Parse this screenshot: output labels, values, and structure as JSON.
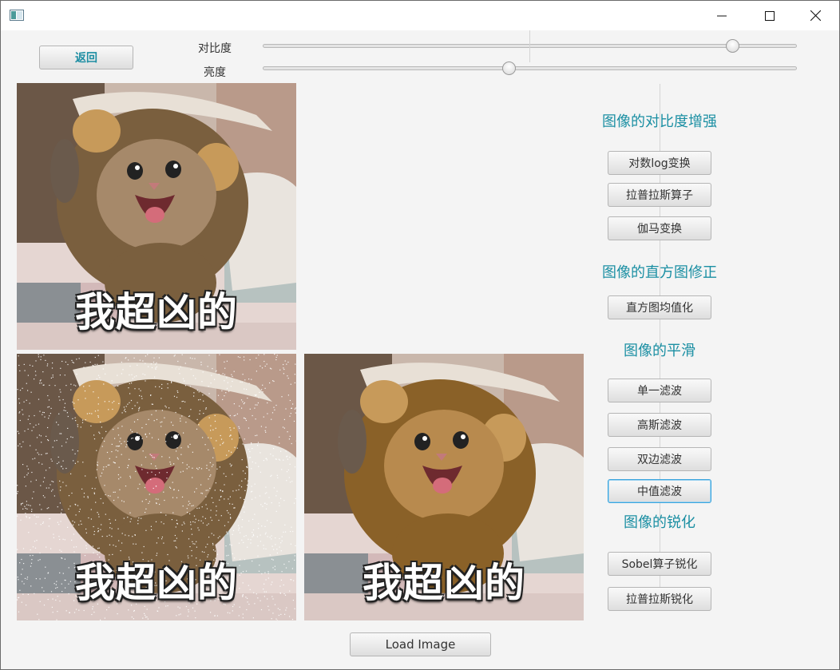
{
  "titlebar": {
    "icons": [
      "app-icon",
      "minimize-icon",
      "maximize-icon",
      "close-icon"
    ]
  },
  "toolbar": {
    "back_label": "返回"
  },
  "sliders": {
    "contrast": {
      "label": "对比度",
      "fraction": 0.89
    },
    "brightness": {
      "label": "亮度",
      "fraction": 0.46
    }
  },
  "images": {
    "original": {
      "caption": "我超凶的",
      "noise": false,
      "warm": false
    },
    "noisy": {
      "caption": "我超凶的",
      "noise": true,
      "warm": false
    },
    "processed": {
      "caption": "我超凶的",
      "noise": false,
      "warm": true
    }
  },
  "panel": {
    "contrast_title": "图像的对比度增强",
    "log_button": "对数log变换",
    "laplace_button": "拉普拉斯算子",
    "gamma_button": "伽马变换",
    "histogram_title": "图像的直方图修正",
    "equalize_button": "直方图均值化",
    "smooth_title": "图像的平滑",
    "box_button": "单一滤波",
    "gauss_button": "高斯滤波",
    "bilateral_button": "双边滤波",
    "median_button": "中值滤波",
    "sharpen_title": "图像的锐化",
    "sobel_button": "Sobel算子锐化",
    "laplace_sharpen_button": "拉普拉斯锐化"
  },
  "footer": {
    "load_label": "Load Image"
  },
  "colors": {
    "accent": "#1b8fa3",
    "focus": "#39a4dd"
  }
}
